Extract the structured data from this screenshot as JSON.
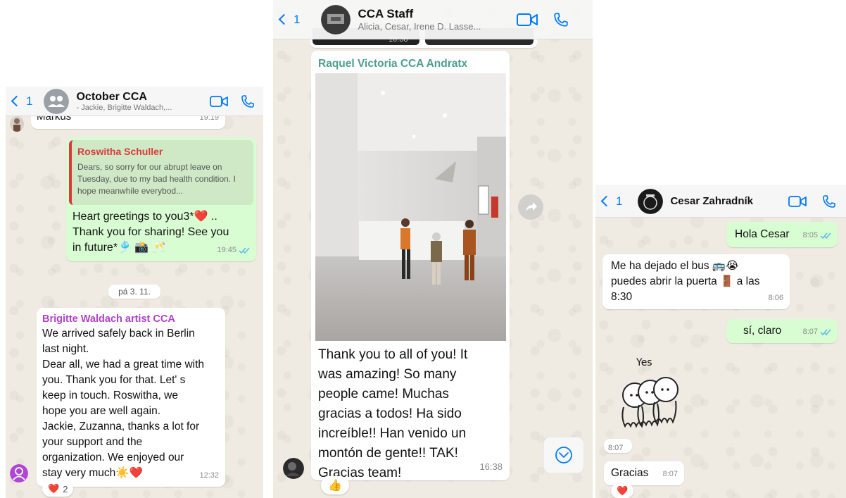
{
  "panel1": {
    "header": {
      "back_count": "1",
      "title": "October CCA",
      "subtitle": "- Jackie, Brigitte Waldach,..."
    },
    "prev_message": {
      "text": "Markus",
      "time": "19:19"
    },
    "reply_message": {
      "quote_sender": "Roswitha Schuller",
      "quote_text": "Dears, so sorry for our abrupt leave on Tuesday, due to my bad health condition. I hope meanwhile everybod...",
      "line1": "Heart greetings to you3*❤️ ..",
      "line2": "Thank you for sharing! See you",
      "line3": "in future*🎐 📸 🥂",
      "time": "19:45"
    },
    "date_chip": "pá 3. 11.",
    "brigitte_message": {
      "sender": "Brigitte Waldach artist CCA",
      "lines": [
        "We arrived safely back in Berlin",
        "last night.",
        "Dear all, we had a great time with",
        "you. Thank you for that. Let' s",
        "keep in touch. Roswitha, we",
        "hope you are well again.",
        "Jackie, Zuzanna, thanks a lot for",
        "your support and the",
        "organization. We enjoyed our",
        "stay very much☀️❤️"
      ],
      "time": "12:32",
      "reaction_emoji": "❤️",
      "reaction_count": "2"
    },
    "colors": {
      "sender_quote": "#d93a3a",
      "sender_brigitte": "#b040c8"
    }
  },
  "panel2": {
    "header": {
      "back_count": "1",
      "title": "CCA Staff",
      "subtitle": "Alicia, Cesar, Irene D. Lasse..."
    },
    "prev_time": "16:38",
    "raquel_message": {
      "sender": "Raquel Victoria CCA Andratx",
      "lines": [
        "Thank you to all of you! It",
        "was amazing! So many",
        "people came! Muchas",
        "gracias a todos! Ha sido",
        "increíble!! Han venido un",
        "montón de gente!! TAK!",
        "Gracias team!"
      ],
      "time": "16:38",
      "reaction_emoji": "👍"
    },
    "colors": {
      "sender_raquel": "#4c9e8f"
    }
  },
  "panel3": {
    "header": {
      "back_count": "1",
      "title": "Cesar Zahradník"
    },
    "messages": {
      "hola": {
        "text": "Hola Cesar",
        "time": "8:05"
      },
      "bus": {
        "line1": "Me ha dejado el bus 🚌😭",
        "line2": "puedes abrir la puerta 🚪 a las",
        "line3": "8:30",
        "time": "8:06"
      },
      "si": {
        "text": "sí, claro",
        "time": "8:07"
      },
      "sticker": {
        "caption": "Yes",
        "time": "8:07"
      },
      "gracias": {
        "text": "Gracias",
        "time": "8:07",
        "reaction_emoji": "❤️"
      }
    }
  }
}
